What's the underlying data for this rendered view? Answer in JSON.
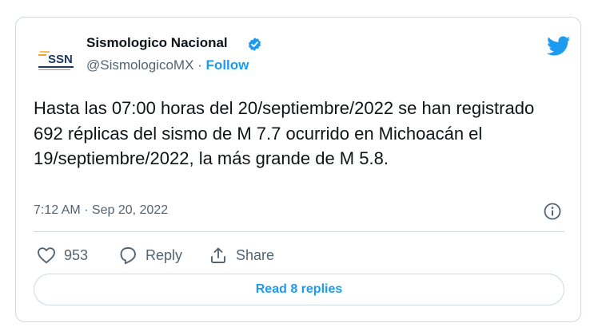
{
  "author": {
    "name": "Sismologico Nacional",
    "handle": "@SismologicoMX",
    "separator": "·",
    "follow_label": "Follow",
    "avatar_text": "SSN",
    "verified_icon": "verified-badge-icon"
  },
  "tweet": {
    "text": "Hasta las 07:00 horas del 20/septiembre/2022 se han registrado 692 réplicas del sismo de M 7.7 ocurrido en Michoacán el 19/septiembre/2022, la más grande de M 5.8.",
    "timestamp": "7:12 AM · Sep 20, 2022"
  },
  "actions": {
    "likes_count": "953",
    "reply_label": "Reply",
    "share_label": "Share"
  },
  "read_replies_label": "Read 8 replies",
  "colors": {
    "accent": "#1d9bf0",
    "text": "#0f1419",
    "secondary": "#536471",
    "border": "#cfd9de",
    "ssn_navy": "#1b3a6b",
    "ssn_orange": "#f5a623"
  }
}
